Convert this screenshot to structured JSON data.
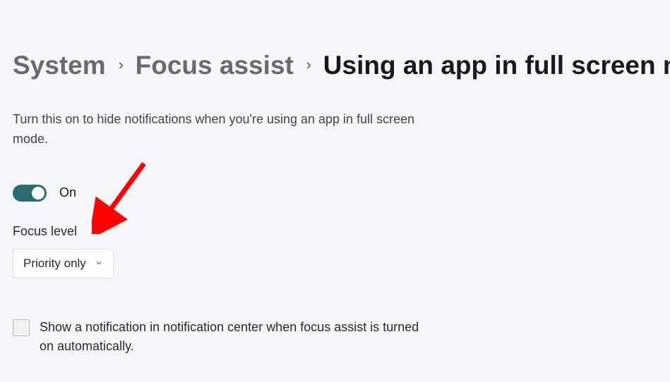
{
  "breadcrumb": {
    "items": [
      {
        "label": "System"
      },
      {
        "label": "Focus assist"
      },
      {
        "label": "Using an app in full screen mode"
      }
    ]
  },
  "description": "Turn this on to hide notifications when you're using an app in full screen mode.",
  "toggle": {
    "state_label": "On",
    "on": true
  },
  "focus_level": {
    "label": "Focus level",
    "selected": "Priority only"
  },
  "checkbox": {
    "label": "Show a notification in notification center when focus assist is turned on automatically.",
    "checked": false
  },
  "annotation": {
    "arrow_color": "#ff0000"
  }
}
